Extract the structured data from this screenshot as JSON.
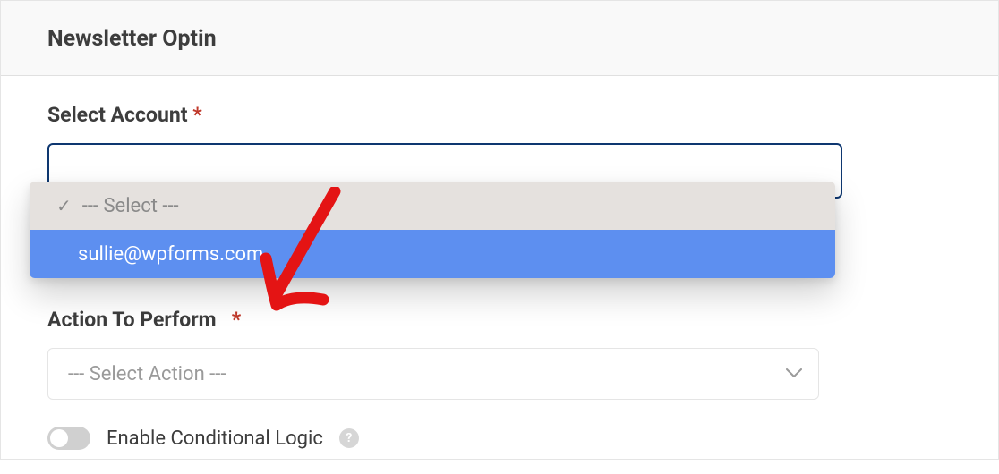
{
  "panel": {
    "title": "Newsletter Optin",
    "select_account": {
      "label": "Select Account",
      "required_mark": "*",
      "placeholder_option": "--- Select ---",
      "options": [
        {
          "label": "--- Select ---",
          "selected": true
        },
        {
          "label": "sullie@wpforms.com",
          "highlighted": true
        }
      ]
    },
    "action_to_perform": {
      "label": "Action To Perform",
      "required_mark": "*",
      "placeholder": "--- Select Action ---"
    },
    "conditional_logic": {
      "label": "Enable Conditional Logic",
      "help": "?",
      "enabled": false
    }
  }
}
